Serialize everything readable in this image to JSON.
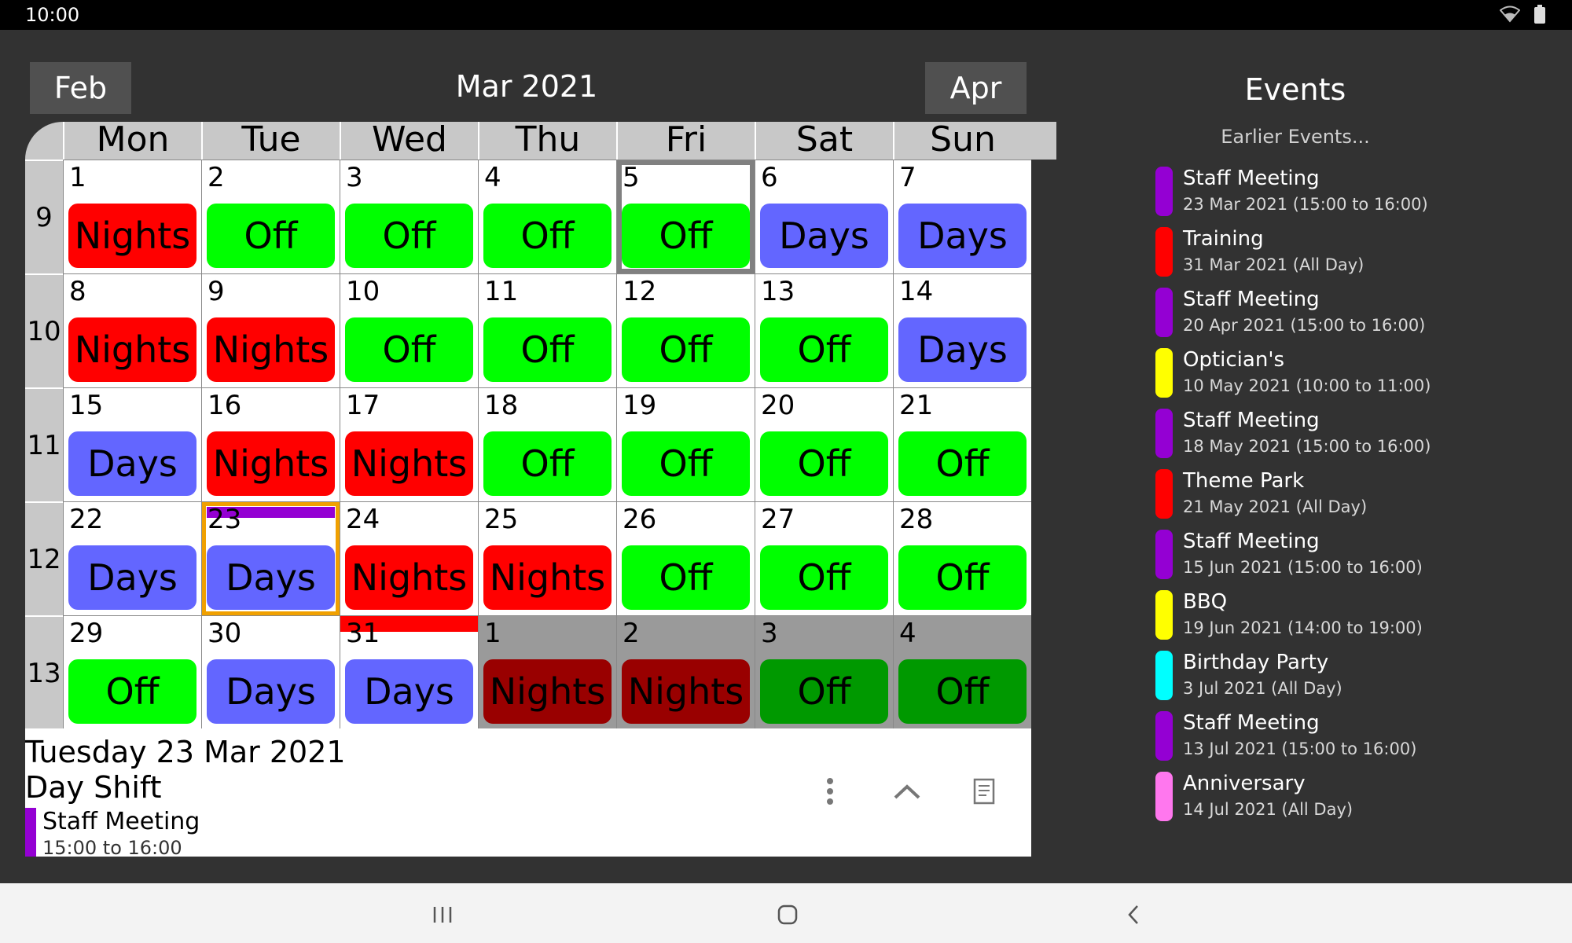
{
  "status": {
    "time": "10:00"
  },
  "header": {
    "prev_label": "Feb",
    "title": "Mar 2021",
    "next_label": "Apr"
  },
  "calendar": {
    "weekdays": [
      "Mon",
      "Tue",
      "Wed",
      "Thu",
      "Fri",
      "Sat",
      "Sun"
    ],
    "weeks": [
      {
        "num": "9",
        "days": [
          {
            "d": "1",
            "shift": "Nights"
          },
          {
            "d": "2",
            "shift": "Off"
          },
          {
            "d": "3",
            "shift": "Off"
          },
          {
            "d": "4",
            "shift": "Off"
          },
          {
            "d": "5",
            "shift": "Off",
            "selected": true
          },
          {
            "d": "6",
            "shift": "Days"
          },
          {
            "d": "7",
            "shift": "Days"
          }
        ]
      },
      {
        "num": "10",
        "days": [
          {
            "d": "8",
            "shift": "Nights"
          },
          {
            "d": "9",
            "shift": "Nights"
          },
          {
            "d": "10",
            "shift": "Off"
          },
          {
            "d": "11",
            "shift": "Off"
          },
          {
            "d": "12",
            "shift": "Off"
          },
          {
            "d": "13",
            "shift": "Off"
          },
          {
            "d": "14",
            "shift": "Days"
          }
        ]
      },
      {
        "num": "11",
        "days": [
          {
            "d": "15",
            "shift": "Days"
          },
          {
            "d": "16",
            "shift": "Nights"
          },
          {
            "d": "17",
            "shift": "Nights"
          },
          {
            "d": "18",
            "shift": "Off"
          },
          {
            "d": "19",
            "shift": "Off"
          },
          {
            "d": "20",
            "shift": "Off"
          },
          {
            "d": "21",
            "shift": "Off"
          }
        ]
      },
      {
        "num": "12",
        "days": [
          {
            "d": "22",
            "shift": "Days"
          },
          {
            "d": "23",
            "shift": "Days",
            "today": true,
            "event_color": "#9400d3"
          },
          {
            "d": "24",
            "shift": "Nights"
          },
          {
            "d": "25",
            "shift": "Nights"
          },
          {
            "d": "26",
            "shift": "Off"
          },
          {
            "d": "27",
            "shift": "Off"
          },
          {
            "d": "28",
            "shift": "Off"
          }
        ]
      },
      {
        "num": "13",
        "days": [
          {
            "d": "29",
            "shift": "Off"
          },
          {
            "d": "30",
            "shift": "Days"
          },
          {
            "d": "31",
            "shift": "Days",
            "event_color": "#ff0000"
          },
          {
            "d": "1",
            "shift": "Nights",
            "other": true
          },
          {
            "d": "2",
            "shift": "Nights",
            "other": true
          },
          {
            "d": "3",
            "shift": "Off",
            "other": true
          },
          {
            "d": "4",
            "shift": "Off",
            "other": true
          }
        ]
      }
    ],
    "shift_colors": {
      "Nights": "#ff0000",
      "Off": "#00ff00",
      "Days": "#6366ff"
    },
    "shift_colors_other": {
      "Nights": "#990000",
      "Off": "#009900",
      "Days": "#3d3f99"
    }
  },
  "detail": {
    "date": "Tuesday 23 Mar 2021",
    "shift": "Day Shift",
    "event_title": "Staff Meeting",
    "event_time": "15:00 to 16:00"
  },
  "events_panel": {
    "title": "Events",
    "earlier_label": "Earlier Events...",
    "items": [
      {
        "name": "Staff Meeting",
        "date": "23 Mar 2021 (15:00 to 16:00)",
        "color": "#9400d3"
      },
      {
        "name": "Training",
        "date": "31 Mar 2021 (All Day)",
        "color": "#ff0000"
      },
      {
        "name": "Staff Meeting",
        "date": "20 Apr 2021 (15:00 to 16:00)",
        "color": "#9400d3"
      },
      {
        "name": "Optician's",
        "date": "10 May 2021 (10:00 to 11:00)",
        "color": "#ffff00"
      },
      {
        "name": "Staff Meeting",
        "date": "18 May 2021 (15:00 to 16:00)",
        "color": "#9400d3"
      },
      {
        "name": "Theme Park",
        "date": "21 May 2021 (All Day)",
        "color": "#ff0000"
      },
      {
        "name": "Staff Meeting",
        "date": "15 Jun 2021 (15:00 to 16:00)",
        "color": "#9400d3"
      },
      {
        "name": "BBQ",
        "date": "19 Jun 2021 (14:00 to 19:00)",
        "color": "#ffff00"
      },
      {
        "name": "Birthday Party",
        "date": "3 Jul 2021 (All Day)",
        "color": "#00ffff"
      },
      {
        "name": "Staff Meeting",
        "date": "13 Jul 2021 (15:00 to 16:00)",
        "color": "#9400d3"
      },
      {
        "name": "Anniversary",
        "date": "14 Jul 2021 (All Day)",
        "color": "#ff77ee"
      }
    ]
  },
  "icons": {
    "wifi": "wifi-icon",
    "battery": "battery-icon",
    "more": "more-vert-icon",
    "collapse": "chevron-up-icon",
    "notes": "notes-icon",
    "recents": "recents-icon",
    "home": "home-icon",
    "back": "back-icon"
  }
}
